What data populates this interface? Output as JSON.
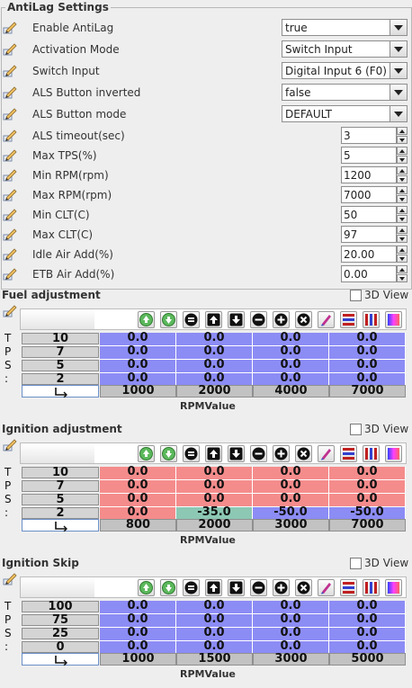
{
  "antilag": {
    "title": "AntiLag Settings",
    "fields": [
      {
        "label": "Enable AntiLag",
        "type": "combo",
        "value": "true"
      },
      {
        "label": "Activation Mode",
        "type": "combo",
        "value": "Switch Input"
      },
      {
        "label": "Switch Input",
        "type": "combo",
        "value": "Digital Input 6 (F0)"
      },
      {
        "label": "ALS Button inverted",
        "type": "combo",
        "value": "false"
      },
      {
        "label": "ALS Button mode",
        "type": "combo",
        "value": "DEFAULT"
      },
      {
        "label": "ALS timeout(sec)",
        "type": "spin",
        "value": "3"
      },
      {
        "label": "Max TPS(%)",
        "type": "spin",
        "value": "5"
      },
      {
        "label": "Min RPM(rpm)",
        "type": "spin",
        "value": "1200"
      },
      {
        "label": "Max RPM(rpm)",
        "type": "spin",
        "value": "7000"
      },
      {
        "label": "Min CLT(C)",
        "type": "spin",
        "value": "50"
      },
      {
        "label": "Max CLT(C)",
        "type": "spin",
        "value": "97"
      },
      {
        "label": "Idle Air Add(%)",
        "type": "spin",
        "value": "20.00"
      },
      {
        "label": "ETB Air Add(%)",
        "type": "spin",
        "value": "0.00"
      }
    ]
  },
  "tables": [
    {
      "title": "Fuel adjustment",
      "view3d_label": "3D View",
      "y_axis_letters": [
        "T",
        "P",
        "S",
        ":"
      ],
      "y_values": [
        "10",
        "7",
        "5",
        "2"
      ],
      "x_values": [
        "1000",
        "2000",
        "4000",
        "7000"
      ],
      "x_axis_name": "RPMValue",
      "rows": [
        [
          "0.0",
          "0.0",
          "0.0",
          "0.0"
        ],
        [
          "0.0",
          "0.0",
          "0.0",
          "0.0"
        ],
        [
          "0.0",
          "0.0",
          "0.0",
          "0.0"
        ],
        [
          "0.0",
          "0.0",
          "0.0",
          "0.0"
        ]
      ],
      "colors": [
        [
          "#8c8cf5",
          "#8c8cf5",
          "#8c8cf5",
          "#8c8cf5"
        ],
        [
          "#8c8cf5",
          "#8c8cf5",
          "#8c8cf5",
          "#8c8cf5"
        ],
        [
          "#8c8cf5",
          "#8c8cf5",
          "#8c8cf5",
          "#8c8cf5"
        ],
        [
          "#8c8cf5",
          "#8c8cf5",
          "#8c8cf5",
          "#8c8cf5"
        ]
      ]
    },
    {
      "title": "Ignition adjustment",
      "view3d_label": "3D View",
      "y_axis_letters": [
        "T",
        "P",
        "S",
        ":"
      ],
      "y_values": [
        "10",
        "7",
        "5",
        "2"
      ],
      "x_values": [
        "800",
        "2000",
        "3000",
        "7000"
      ],
      "x_axis_name": "RPMValue",
      "rows": [
        [
          "0.0",
          "0.0",
          "0.0",
          "0.0"
        ],
        [
          "0.0",
          "0.0",
          "0.0",
          "0.0"
        ],
        [
          "0.0",
          "0.0",
          "0.0",
          "0.0"
        ],
        [
          "0.0",
          "-35.0",
          "-50.0",
          "-50.0"
        ]
      ],
      "colors": [
        [
          "#f58c8c",
          "#f58c8c",
          "#f58c8c",
          "#f58c8c"
        ],
        [
          "#f58c8c",
          "#f58c8c",
          "#f58c8c",
          "#f58c8c"
        ],
        [
          "#f58c8c",
          "#f58c8c",
          "#f58c8c",
          "#f58c8c"
        ],
        [
          "#f58c8c",
          "#8cc8b4",
          "#8c8cf5",
          "#8c8cf5"
        ]
      ]
    },
    {
      "title": "Ignition Skip",
      "view3d_label": "3D View",
      "y_axis_letters": [
        "T",
        "P",
        "S",
        ":"
      ],
      "y_values": [
        "100",
        "75",
        "25",
        "0"
      ],
      "x_values": [
        "1000",
        "1500",
        "3000",
        "5000"
      ],
      "x_axis_name": "RPMValue",
      "rows": [
        [
          "0.0",
          "0.0",
          "0.0",
          "0.0"
        ],
        [
          "0.0",
          "0.0",
          "0.0",
          "0.0"
        ],
        [
          "0.0",
          "0.0",
          "0.0",
          "0.0"
        ],
        [
          "0.0",
          "0.0",
          "0.0",
          "0.0"
        ]
      ],
      "colors": [
        [
          "#8c8cf5",
          "#8c8cf5",
          "#8c8cf5",
          "#8c8cf5"
        ],
        [
          "#8c8cf5",
          "#8c8cf5",
          "#8c8cf5",
          "#8c8cf5"
        ],
        [
          "#8c8cf5",
          "#8c8cf5",
          "#8c8cf5",
          "#8c8cf5"
        ],
        [
          "#8c8cf5",
          "#8c8cf5",
          "#8c8cf5",
          "#8c8cf5"
        ]
      ]
    }
  ],
  "toolbar_icons": [
    "increment-green-up-icon",
    "decrement-green-down-icon",
    "set-equal-icon",
    "arrow-up-icon",
    "arrow-down-icon",
    "minus-icon",
    "plus-icon",
    "multiply-icon",
    "interpolate-pencil-icon",
    "horizontal-gradient-icon",
    "vertical-gradient-icon",
    "color-spectrum-icon"
  ]
}
